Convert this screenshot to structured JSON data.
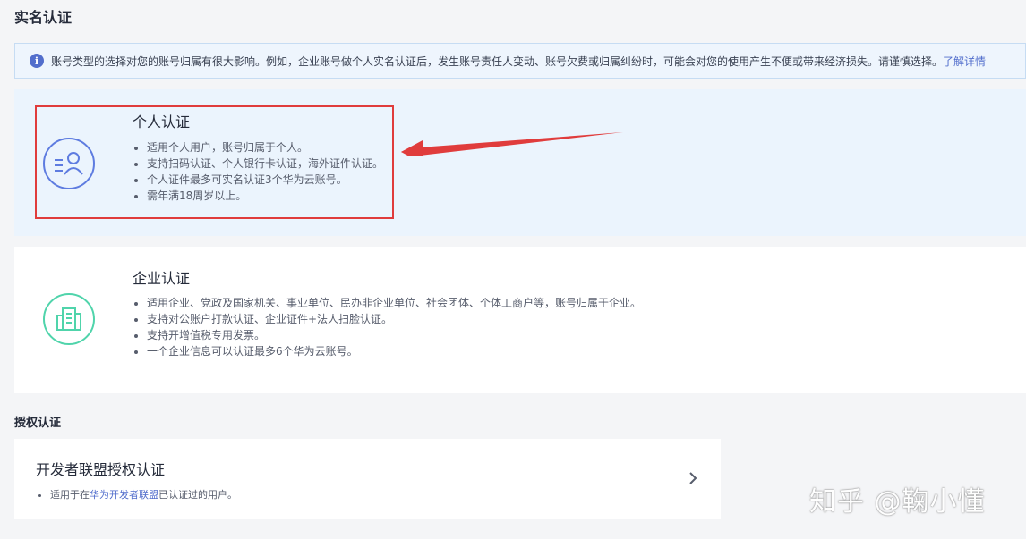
{
  "page": {
    "title": "实名认证"
  },
  "notice": {
    "icon": "info-icon",
    "text": "账号类型的选择对您的账号归属有很大影响。例如，企业账号做个人实名认证后，发生账号责任人变动、账号欠费或归属纠纷时，可能会对您的使用产生不便或带来经济损失。请谨慎选择。",
    "link": "了解详情"
  },
  "personal": {
    "icon": "user-id-icon",
    "title": "个人认证",
    "items": [
      "适用个人用户，账号归属于个人。",
      "支持扫码认证、个人银行卡认证，海外证件认证。",
      "个人证件最多可实名认证3个华为云账号。",
      "需年满18周岁以上。"
    ]
  },
  "enterprise": {
    "icon": "building-icon",
    "title": "企业认证",
    "items": [
      "适用企业、党政及国家机关、事业单位、民办非企业单位、社会团体、个体工商户等，账号归属于企业。",
      "支持对公账户打款认证、企业证件+法人扫脸认证。",
      "支持开增值税专用发票。",
      "一个企业信息可以认证最多6个华为云账号。"
    ]
  },
  "authorization": {
    "section_title": "授权认证",
    "card_title": "开发者联盟授权认证",
    "desc_prefix": "适用于在",
    "desc_link": "华为开发者联盟",
    "desc_suffix": "已认证过的用户。",
    "chevron": "chevron-right-icon"
  },
  "watermark": "知乎 @鞠小懂",
  "colors": {
    "accent": "#526ecc",
    "highlight": "#e03c3c",
    "enterprise_icon": "#50d4ab"
  }
}
